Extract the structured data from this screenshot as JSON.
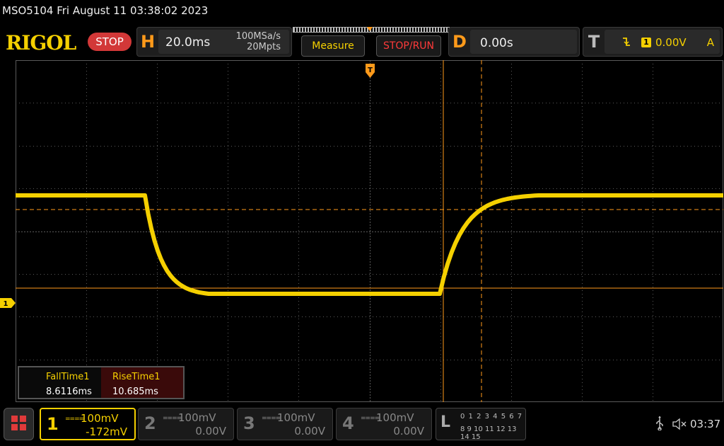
{
  "window": {
    "title": "MSO5104  Fri August 11 03:38:02 2023"
  },
  "header": {
    "logo": "RIGOL",
    "run_state": "STOP",
    "horizontal": {
      "letter": "H",
      "timebase": "20.0ms",
      "sample_rate": "100MSa/s",
      "memory_depth": "20Mpts"
    },
    "measure_label": "Measure",
    "stop_run_label": "STOP/RUN",
    "delay": {
      "letter": "D",
      "value": "0.00s"
    },
    "trigger": {
      "letter": "T",
      "slope_icon": "falling-edge-icon",
      "source": "1",
      "level": "0.00V",
      "mode": "A"
    }
  },
  "display": {
    "trigger_marker_label": "T",
    "ch1_marker_label": "1",
    "colors": {
      "trace": "#f5d000",
      "cursor": "#ff9a1a",
      "grid": "#5a5a5a"
    },
    "measurements": [
      {
        "name": "FallTime1",
        "value": "8.6116ms"
      },
      {
        "name": "RiseTime1",
        "value": "10.685ms"
      }
    ]
  },
  "footer": {
    "menu_icon": "menu-grid-icon",
    "channels": [
      {
        "num": "1",
        "coupling": "====",
        "scale": "100mV",
        "offset": "-172mV",
        "active": true
      },
      {
        "num": "2",
        "coupling": "====",
        "scale": "100mV",
        "offset": "0.00V",
        "active": false
      },
      {
        "num": "3",
        "coupling": "====",
        "scale": "100mV",
        "offset": "0.00V",
        "active": false
      },
      {
        "num": "4",
        "coupling": "====",
        "scale": "100mV",
        "offset": "0.00V",
        "active": false
      }
    ],
    "la": {
      "letter": "L",
      "row1": "0 1 2 3  4 5 6 7",
      "row2": "8 9 10 11 12 13 14 15"
    },
    "usb_icon": "usb-icon",
    "speaker_icon": "speaker-muted-icon",
    "clock": "03:37"
  }
}
